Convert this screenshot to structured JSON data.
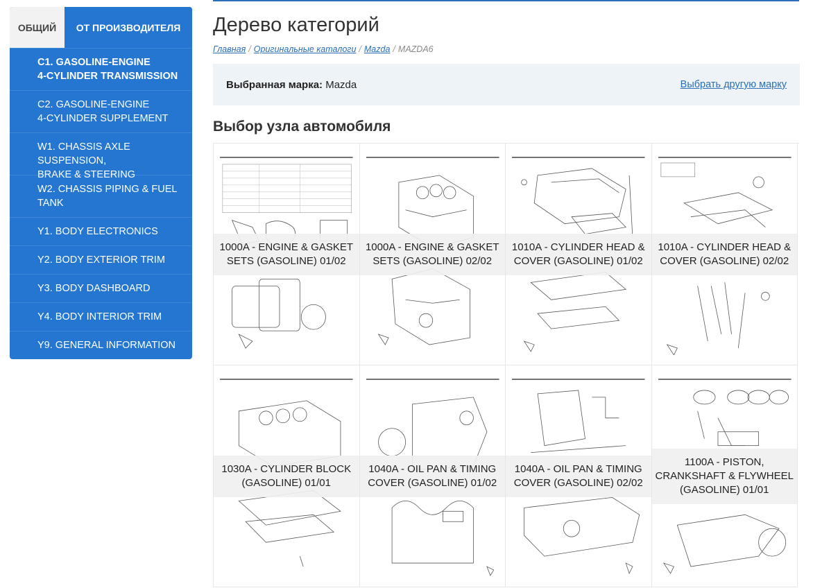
{
  "sidebar": {
    "tabs": [
      {
        "label": "ОБЩИЙ"
      },
      {
        "label": "ОТ ПРОИЗВОДИТЕЛЯ"
      }
    ],
    "items": [
      {
        "label": "C1. GASOLINE-ENGINE\n4-CYLINDER TRANSMISSION"
      },
      {
        "label": "C2. GASOLINE-ENGINE\n4-CYLINDER SUPPLEMENT"
      },
      {
        "label": "W1. CHASSIS AXLE SUSPENSION,\nBRAKE & STEERING"
      },
      {
        "label": "W2. CHASSIS PIPING & FUEL\nTANK"
      },
      {
        "label": "Y1. BODY ELECTRONICS"
      },
      {
        "label": "Y2. BODY EXTERIOR TRIM"
      },
      {
        "label": "Y3. BODY DASHBOARD"
      },
      {
        "label": "Y4. BODY INTERIOR TRIM"
      },
      {
        "label": "Y9. GENERAL INFORMATION"
      }
    ]
  },
  "header": {
    "title": "Дерево категорий",
    "breadcrumb": {
      "home": "Главная",
      "catalogs": "Оригинальные каталоги",
      "brand": "Mazda",
      "current": "MAZDA6",
      "sep": "/"
    }
  },
  "brand_panel": {
    "label": "Выбранная марка:",
    "value": "Mazda",
    "change_link": "Выбрать другую марку"
  },
  "section_title": "Выбор узла автомобиля",
  "cards": [
    {
      "title": "1000A - ENGINE & GASKET SETS (GASOLINE) 01/02"
    },
    {
      "title": "1000A - ENGINE & GASKET SETS (GASOLINE) 02/02"
    },
    {
      "title": "1010A - CYLINDER HEAD & COVER (GASOLINE) 01/02"
    },
    {
      "title": "1010A - CYLINDER HEAD & COVER (GASOLINE) 02/02"
    },
    {
      "title": "1030A - CYLINDER BLOCK (GASOLINE) 01/01"
    },
    {
      "title": "1040A - OIL PAN & TIMING COVER (GASOLINE) 01/02"
    },
    {
      "title": "1040A - OIL PAN & TIMING COVER (GASOLINE) 02/02"
    },
    {
      "title": "1100A - PISTON, CRANKSHAFT & FLYWHEEL (GASOLINE) 01/01"
    }
  ],
  "colors": {
    "accent": "#2476d0",
    "link": "#2a6fb8",
    "panel": "#eef3f7"
  }
}
